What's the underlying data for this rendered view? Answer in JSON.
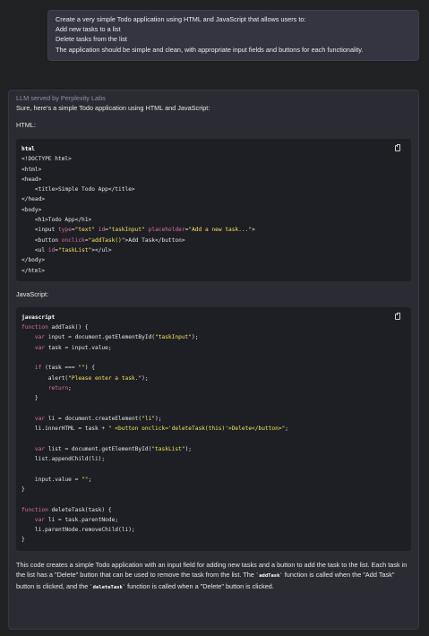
{
  "user_message": {
    "lines": [
      "Create a very simple Todo application using HTML and JavaScript that allows users to:",
      "Add new tasks to a list",
      "Delete tasks from the list",
      "The application should be simple and clean, with appropriate input fields and buttons for each functionality."
    ]
  },
  "assistant": {
    "served_by": "LLM served by Perplexity Labs",
    "intro": "Sure, here's a simple Todo application using HTML and JavaScript:",
    "html_heading": "HTML:",
    "html_block": {
      "lang": "html",
      "copy_icon": "clipboard-icon",
      "lines": [
        "<!DOCTYPE html>",
        "<html>",
        "<head>",
        "    <title>Simple Todo App</title>",
        "</head>",
        "<body>",
        "    <h1>Todo App</h1>",
        "    <input type=\"text\" id=\"taskInput\" placeholder=\"Add a new task...\">",
        "    <button onclick=\"addTask()\">Add Task</button>",
        "    <ul id=\"taskList\"></ul>",
        "</body>",
        "</html>"
      ]
    },
    "js_heading": "JavaScript:",
    "js_block": {
      "lang": "javascript",
      "copy_icon": "clipboard-icon",
      "lines": [
        "function addTask() {",
        "    var input = document.getElementById(\"taskInput\");",
        "    var task = input.value;",
        "",
        "    if (task === \"\") {",
        "        alert(\"Please enter a task.\");",
        "        return;",
        "    }",
        "",
        "    var li = document.createElement(\"li\");",
        "    li.innerHTML = task + \" <button onclick='deleteTask(this)'>Delete</button>\";",
        "",
        "    var list = document.getElementById(\"taskList\");",
        "    list.appendChild(li);",
        "",
        "    input.value = \"\";",
        "}",
        "",
        "function deleteTask(task) {",
        "    var li = task.parentNode;",
        "    li.parentNode.removeChild(li);",
        "}"
      ]
    },
    "summary": {
      "part1": "This code creates a simple Todo application with an input field for adding new tasks and a button to add the task to the list. Each task in the list has a \"Delete\" button that can be used to remove the task from the list. The ",
      "code1": "`addTask`",
      "part2": " function is called when the \"Add Task\" button is clicked, and the ",
      "code2": "`deleteTask`",
      "part3": " function is called when a \"Delete\" button is clicked."
    }
  }
}
